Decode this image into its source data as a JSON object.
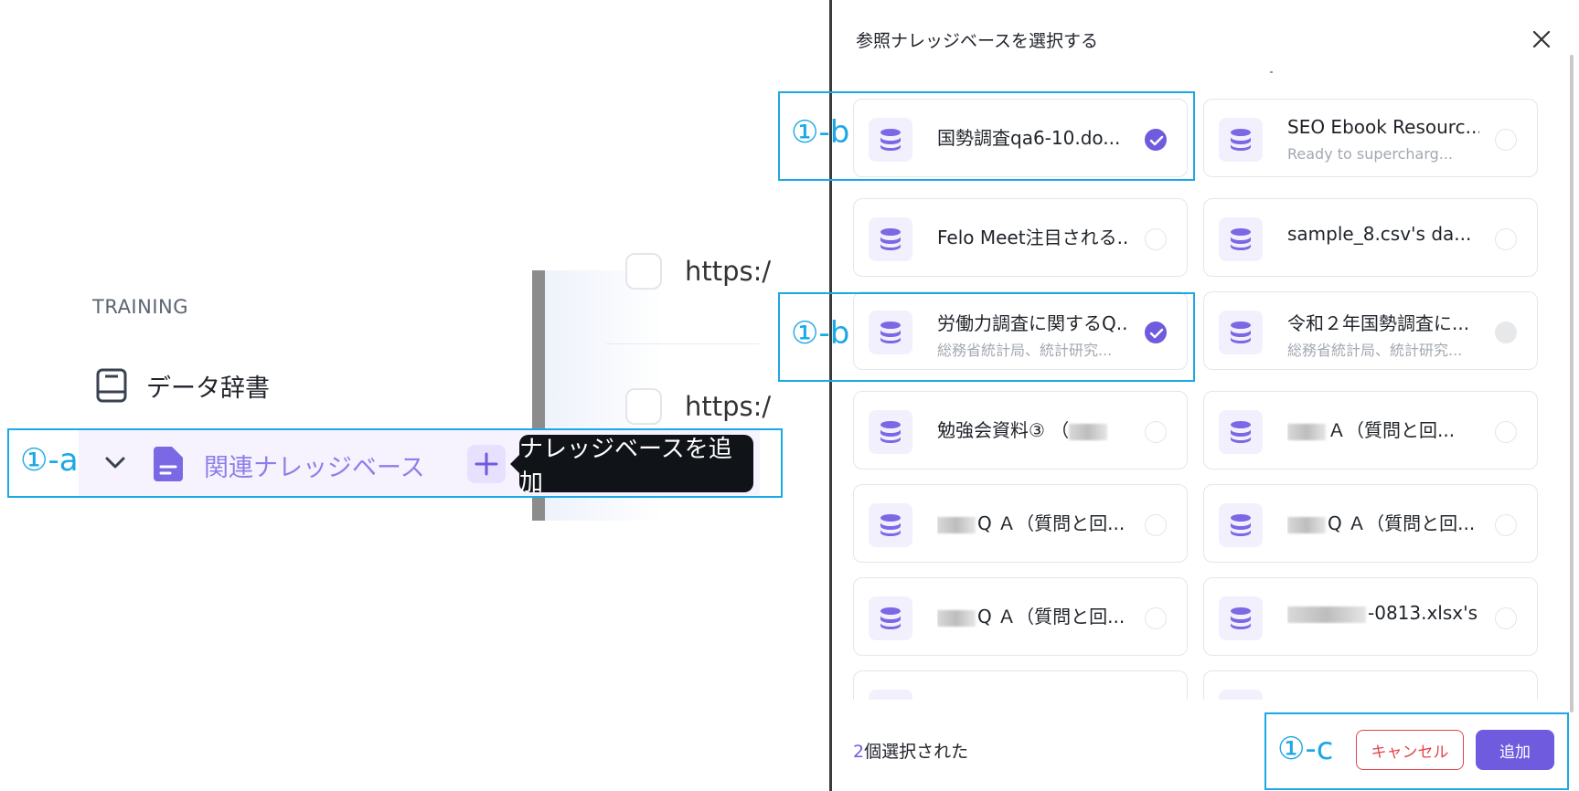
{
  "sidebar": {
    "section_label": "TRAINING",
    "data_dictionary": "データ辞書",
    "knowledge_base": "関連ナレッジベース",
    "add_tooltip": "ナレッジベースを追加"
  },
  "background": {
    "rows": [
      {
        "url": "https:/"
      },
      {
        "url": "https:/"
      }
    ]
  },
  "annotations": {
    "a": "①-a",
    "b1": "①-b",
    "b2": "①-b",
    "c": "①-c"
  },
  "modal": {
    "title": "参照ナレッジベースを選択する",
    "cards": [
      {
        "title": "国勢調査qa6-10.do...",
        "subtitle": "",
        "state": "checked"
      },
      {
        "title": "SEO Ebook Resourc...",
        "subtitle": "Ready to supercharg...",
        "state": "unchecked"
      },
      {
        "title": "Felo Meet注目される...",
        "subtitle": "",
        "state": "unchecked"
      },
      {
        "title": "sample_8.csv's da...",
        "subtitle": "",
        "state": "unchecked"
      },
      {
        "title": "労働力調査に関するQ...",
        "subtitle": "総務省統計局、統計研究...",
        "state": "checked"
      },
      {
        "title": "令和２年国勢調査に...",
        "subtitle": "総務省統計局、統計研究...",
        "state": "disabled"
      },
      {
        "title": "勉強会資料③ （",
        "subtitle": "",
        "state": "unchecked"
      },
      {
        "title": "Ａ（質問と回...",
        "subtitle": "",
        "state": "unchecked"
      },
      {
        "title": "Q Ａ（質問と回...",
        "subtitle": "",
        "state": "unchecked"
      },
      {
        "title": "Q Ａ（質問と回...",
        "subtitle": "",
        "state": "unchecked"
      },
      {
        "title": "Q Ａ（質問と回...",
        "subtitle": "",
        "state": "unchecked"
      },
      {
        "title": "-0813.xlsx's...",
        "subtitle": "",
        "state": "unchecked"
      }
    ],
    "selected_count": "2",
    "selected_suffix": "個選択された",
    "cancel_label": "キャンセル",
    "add_label": "追加"
  },
  "colors": {
    "accent": "#6e5bde",
    "accent_light": "#8d7fe8",
    "annotation": "#1ba8e6",
    "danger": "#e0454a"
  }
}
